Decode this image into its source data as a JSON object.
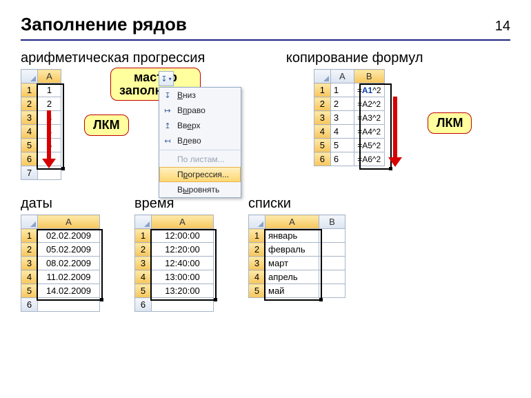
{
  "page_number": "14",
  "title": "Заполнение рядов",
  "sections": {
    "arith": "арифметическая прогрессия",
    "formulas": "копирование формул",
    "dates": "даты",
    "time": "время",
    "lists": "списки"
  },
  "lkm_label": "ЛКМ",
  "master_label_line1": "мастер",
  "master_label_line2": "заполнения",
  "arith_table": {
    "col": "A",
    "rows": [
      "1",
      "2",
      "3",
      "4",
      "5",
      "6",
      "7"
    ],
    "values": [
      "1",
      "2",
      "3",
      "4",
      "5",
      "6",
      ""
    ]
  },
  "formulas_table": {
    "cols": [
      "A",
      "B"
    ],
    "rows": [
      "1",
      "2",
      "3",
      "4",
      "5",
      "6"
    ],
    "a_values": [
      "1",
      "2",
      "3",
      "4",
      "5",
      "6"
    ],
    "b_refs": [
      "A1",
      "A2",
      "A3",
      "A4",
      "A5",
      "A6"
    ],
    "b_suffix": "^2"
  },
  "dates_table": {
    "col": "A",
    "rows": [
      "1",
      "2",
      "3",
      "4",
      "5",
      "6"
    ],
    "values": [
      "02.02.2009",
      "05.02.2009",
      "08.02.2009",
      "11.02.2009",
      "14.02.2009",
      ""
    ]
  },
  "time_table": {
    "col": "A",
    "rows": [
      "1",
      "2",
      "3",
      "4",
      "5",
      "6"
    ],
    "values": [
      "12:00:00",
      "12:20:00",
      "12:40:00",
      "13:00:00",
      "13:20:00",
      ""
    ]
  },
  "lists_table": {
    "cols": [
      "A",
      "B"
    ],
    "rows": [
      "1",
      "2",
      "3",
      "4",
      "5"
    ],
    "a_values": [
      "январь",
      "февраль",
      "март",
      "апрель",
      "май"
    ]
  },
  "menu": {
    "down": "Вниз",
    "right": "Вправо",
    "up": "Вверх",
    "left": "Влево",
    "sheets": "По листам...",
    "progression": "Прогрессия...",
    "justify": "Выровнять"
  }
}
